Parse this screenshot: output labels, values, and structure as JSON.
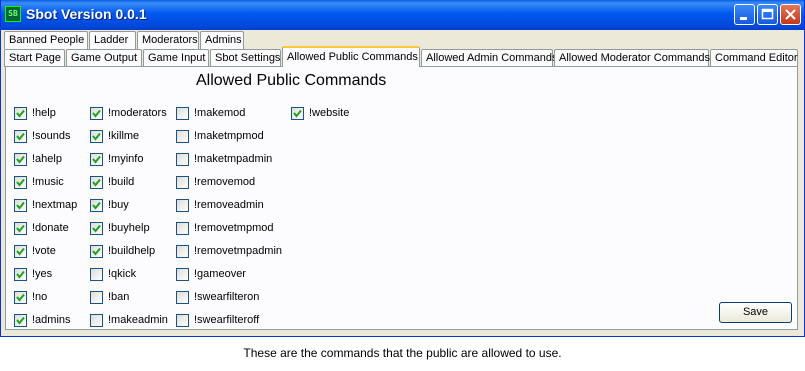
{
  "window": {
    "title": "Sbot Version 0.0.1",
    "icon": "sb-app-icon"
  },
  "tabs": {
    "row1": [
      "Banned People",
      "Ladder",
      "Moderators",
      "Admins"
    ],
    "row2": [
      "Start Page",
      "Game Output",
      "Game Input",
      "Sbot Settings",
      "Allowed Public Commands",
      "Allowed Admin Commands",
      "Allowed Moderator Commands",
      "Command Editor"
    ],
    "active": "Allowed Public Commands"
  },
  "page": {
    "heading": "Allowed Public Commands",
    "columns": [
      [
        {
          "label": "!help",
          "checked": true
        },
        {
          "label": "!sounds",
          "checked": true
        },
        {
          "label": "!ahelp",
          "checked": true
        },
        {
          "label": "!music",
          "checked": true
        },
        {
          "label": "!nextmap",
          "checked": true
        },
        {
          "label": "!donate",
          "checked": true
        },
        {
          "label": "!vote",
          "checked": true
        },
        {
          "label": "!yes",
          "checked": true
        },
        {
          "label": "!no",
          "checked": true
        },
        {
          "label": "!admins",
          "checked": true
        }
      ],
      [
        {
          "label": "!moderators",
          "checked": true
        },
        {
          "label": "!killme",
          "checked": true
        },
        {
          "label": "!myinfo",
          "checked": true
        },
        {
          "label": "!build",
          "checked": true
        },
        {
          "label": "!buy",
          "checked": true
        },
        {
          "label": "!buyhelp",
          "checked": true
        },
        {
          "label": "!buildhelp",
          "checked": true
        },
        {
          "label": "!qkick",
          "checked": false
        },
        {
          "label": "!ban",
          "checked": false
        },
        {
          "label": "!makeadmin",
          "checked": false
        }
      ],
      [
        {
          "label": "!makemod",
          "checked": false
        },
        {
          "label": "!maketmpmod",
          "checked": false
        },
        {
          "label": "!maketmpadmin",
          "checked": false
        },
        {
          "label": "!removemod",
          "checked": false
        },
        {
          "label": "!removeadmin",
          "checked": false
        },
        {
          "label": "!removetmpmod",
          "checked": false
        },
        {
          "label": "!removetmpadmin",
          "checked": false
        },
        {
          "label": "!gameover",
          "checked": false
        },
        {
          "label": "!swearfilteron",
          "checked": false
        },
        {
          "label": "!swearfilteroff",
          "checked": false
        }
      ],
      [
        {
          "label": "!website",
          "checked": true
        }
      ]
    ],
    "save_label": "Save"
  },
  "caption": "These are the commands that the public are allowed to use.",
  "colors": {
    "check": "#21a121",
    "titlebar": "#0054e3",
    "active_tab_accent": "#ffc83c"
  }
}
